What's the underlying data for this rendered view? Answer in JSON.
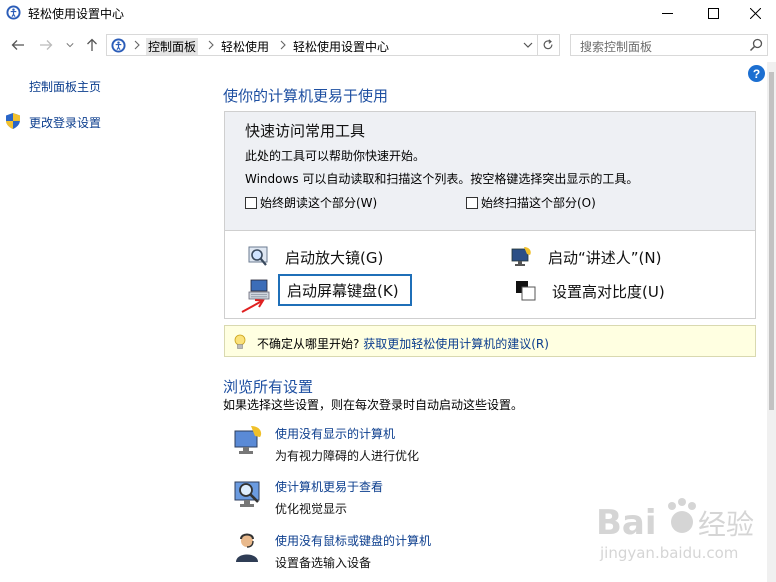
{
  "window": {
    "title": "轻松使用设置中心",
    "icon": "ease-of-access-icon"
  },
  "address_bar": {
    "crumbs": [
      "控制面板",
      "轻松使用",
      "轻松使用设置中心"
    ]
  },
  "search": {
    "placeholder": "搜索控制面板"
  },
  "sidebar": {
    "home": "控制面板主页",
    "change_login": "更改登录设置"
  },
  "main": {
    "title": "使你的计算机更易于使用",
    "quick_access": {
      "title": "快速访问常用工具",
      "line1": "此处的工具可以帮助你快速开始。",
      "line2": "Windows 可以自动读取和扫描这个列表。按空格键选择突出显示的工具。",
      "check_read": "始终朗读这个部分(W)",
      "check_scan": "始终扫描这个部分(O)",
      "tools": [
        {
          "label": "启动放大镜(G)",
          "icon": "magnifier-icon"
        },
        {
          "label": "启动“讲述人”(N)",
          "icon": "narrator-icon"
        },
        {
          "label": "启动屏幕键盘(K)",
          "icon": "keyboard-icon"
        },
        {
          "label": "设置高对比度(U)",
          "icon": "contrast-icon"
        }
      ]
    },
    "tip": {
      "prefix": "不确定从哪里开始?",
      "link": "获取更加轻松使用计算机的建议(R)"
    },
    "browse": {
      "title": "浏览所有设置",
      "desc": "如果选择这些设置，则在每次登录时自动启动这些设置。",
      "items": [
        {
          "link": "使用没有显示的计算机",
          "desc": "为有视力障碍的人进行优化"
        },
        {
          "link": "使计算机更易于查看",
          "desc": "优化视觉显示"
        },
        {
          "link": "使用没有鼠标或键盘的计算机",
          "desc": "设置备选输入设备"
        }
      ]
    }
  },
  "watermark": {
    "brand": "Bai",
    "brand_tail": "经验",
    "url": "jingyan.baidu.com"
  },
  "colors": {
    "link": "#0c3e8e",
    "heading": "#1e4fa1",
    "highlight_border": "#1f6fb8",
    "tip_bg": "#ffffe1"
  }
}
